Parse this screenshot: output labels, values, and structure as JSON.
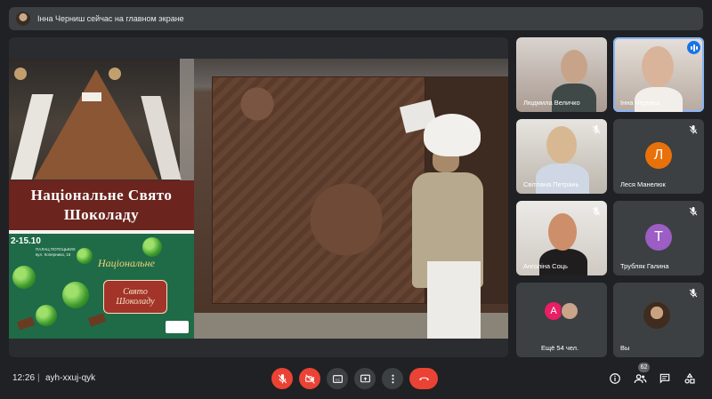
{
  "banner": {
    "text": "Інна Черниш сейчас на главном экране"
  },
  "presentation": {
    "title_line1": "Національне Свято",
    "title_line2": "Шоколаду",
    "poster": {
      "dates": "2-15.10",
      "address_line1": "ПАЛАЦ ПОТОЦЬКИХ",
      "address_line2": "вул. Коперника, 15",
      "script_title": "Національне",
      "banner_line1": "Свято",
      "banner_line2": "Шоколаду"
    }
  },
  "participants": [
    {
      "name": "Людмила Величко",
      "type": "video",
      "muted": false
    },
    {
      "name": "Інна Черниш",
      "type": "video",
      "muted": false,
      "speaking": true
    },
    {
      "name": "Світлана Петрань",
      "type": "video",
      "muted": true
    },
    {
      "name": "Леся Манелюк",
      "type": "avatar",
      "letter": "Л",
      "color": "#e8710a",
      "muted": true
    },
    {
      "name": "Анголіна Соць",
      "type": "video",
      "muted": true
    },
    {
      "name": "Трубляк Галина",
      "type": "avatar",
      "letter": "Т",
      "color": "#9c5dc4",
      "muted": true
    },
    {
      "name": "Ещё 54 чел.",
      "type": "more",
      "letter": "А",
      "color": "#e91e63"
    },
    {
      "name": "Вы",
      "type": "self",
      "muted": true
    }
  ],
  "bottom_bar": {
    "time": "12:26",
    "separator": "|",
    "meeting_code": "ayh-xxuj-qyk",
    "participant_count": "62"
  },
  "icons": {
    "mic": "mic-off-icon",
    "camera": "camera-off-icon",
    "captions": "captions-icon",
    "present": "present-icon",
    "more": "more-vert-icon",
    "leave": "call-end-icon",
    "info": "info-icon",
    "people": "people-icon",
    "chat": "chat-icon",
    "activities": "activities-icon"
  },
  "colors": {
    "background": "#202124",
    "tile": "#3c4043",
    "danger": "#ea4335",
    "accent": "#1a73e8"
  }
}
